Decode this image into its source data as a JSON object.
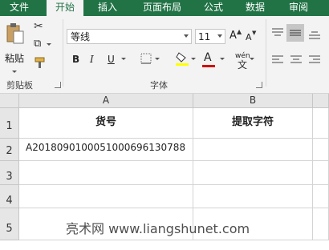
{
  "tabs": [
    {
      "label": "文件",
      "active": false
    },
    {
      "label": "开始",
      "active": true
    },
    {
      "label": "插入",
      "active": false
    },
    {
      "label": "页面布局",
      "active": false
    },
    {
      "label": "公式",
      "active": false
    },
    {
      "label": "数据",
      "active": false
    },
    {
      "label": "审阅",
      "active": false
    }
  ],
  "ribbon": {
    "clipboard": {
      "paste_label": "粘贴",
      "group_label": "剪贴板"
    },
    "font": {
      "font_name": "等线",
      "font_size": "11",
      "grow_label": "A",
      "shrink_label": "A",
      "bold_label": "B",
      "italic_label": "I",
      "underline_label": "U",
      "font_color_label": "A",
      "phonetic_label": "wén",
      "group_label": "字体"
    }
  },
  "sheet": {
    "columns": [
      "A",
      "B"
    ],
    "rows": [
      "1",
      "2",
      "3",
      "4",
      "5"
    ],
    "cells": {
      "A1": "货号",
      "B1": "提取字符",
      "A2": "A2018090100051000696130788"
    }
  },
  "watermark": "亮术网 www.liangshunet.com",
  "colors": {
    "accent": "#217346",
    "font_color": "#d00000",
    "highlight": "#ffff00"
  }
}
